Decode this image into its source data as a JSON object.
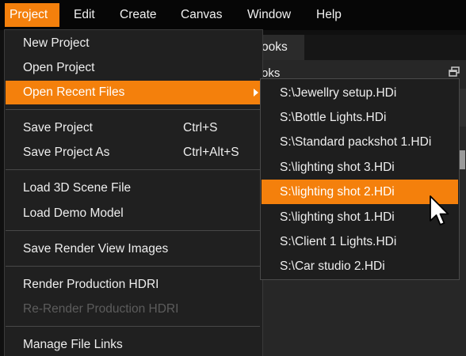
{
  "menubar": {
    "items": [
      {
        "label": "Project",
        "active": true
      },
      {
        "label": "Edit"
      },
      {
        "label": "Create"
      },
      {
        "label": "Canvas"
      },
      {
        "label": "Window"
      },
      {
        "label": "Help"
      }
    ]
  },
  "background": {
    "tab_label": "ooks",
    "panel_title": "oks"
  },
  "project_menu": {
    "new_project": "New Project",
    "open_project": "Open Project",
    "open_recent_files": "Open Recent Files",
    "save_project": "Save Project",
    "save_project_shortcut": "Ctrl+S",
    "save_project_as": "Save Project As",
    "save_project_as_shortcut": "Ctrl+Alt+S",
    "load_3d_scene_file": "Load 3D Scene File",
    "load_demo_model": "Load Demo Model",
    "save_render_view_images": "Save Render View Images",
    "render_production_hdri": "Render Production HDRI",
    "re_render_production_hdri": "Re-Render Production HDRI",
    "manage_file_links": "Manage File Links"
  },
  "recent_files": [
    "S:\\Jewellry setup.HDi",
    "S:\\Bottle Lights.HDi",
    "S:\\Standard packshot 1.HDi",
    "S:\\lighting shot 3.HDi",
    "S:\\lighting shot 2.HDi",
    "S:\\lighting shot 1.HDi",
    "S:\\Client 1 Lights.HDi",
    "S:\\Car studio 2.HDi"
  ],
  "colors": {
    "accent": "#f4800c",
    "menu_bg": "#202020",
    "menubar_bg": "#060606",
    "disabled_text": "#5c5c5c"
  }
}
